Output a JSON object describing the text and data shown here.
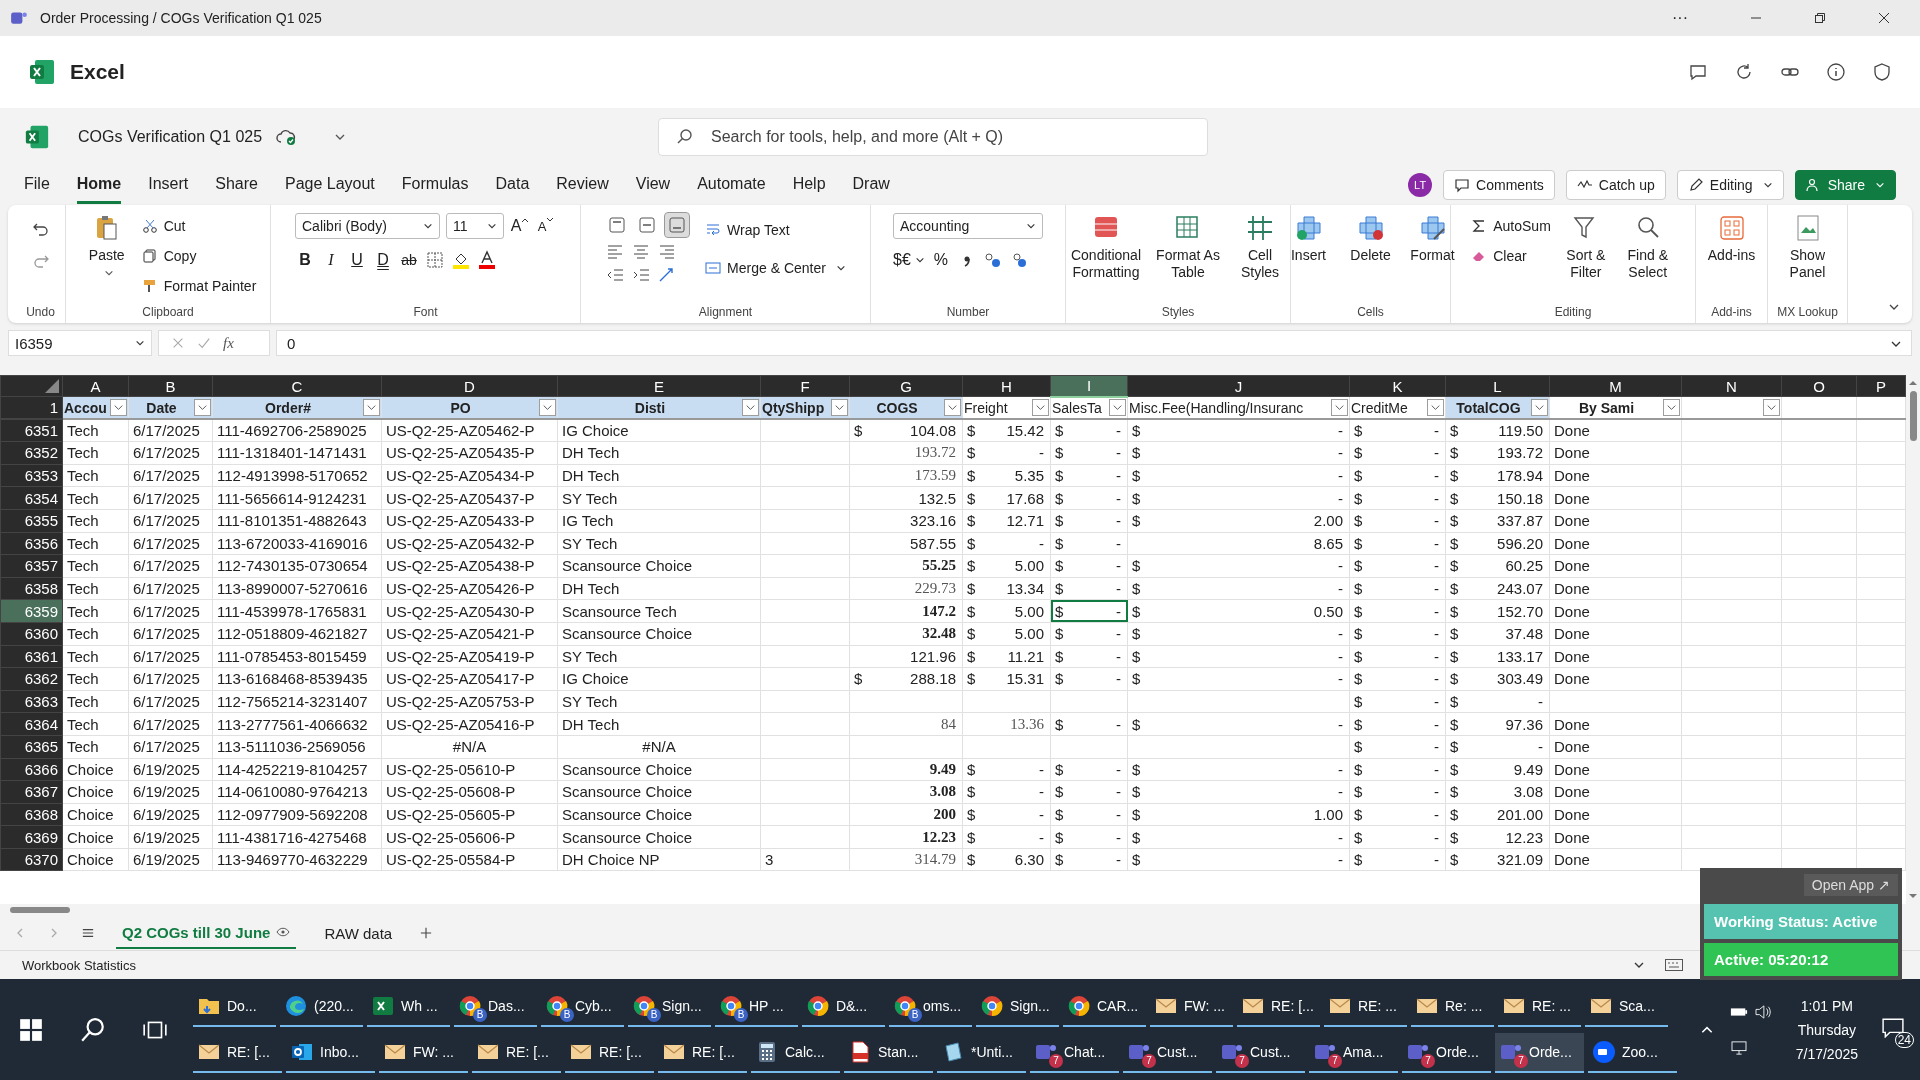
{
  "window": {
    "title": "Order Processing / COGs Verification Q1 025",
    "more": "···"
  },
  "app": {
    "name": "Excel"
  },
  "document": {
    "name": "COGs Verification Q1 025"
  },
  "search": {
    "placeholder": "Search for tools, help, and more (Alt + Q)"
  },
  "menu_tabs": [
    {
      "label": "File",
      "selected": false
    },
    {
      "label": "Home",
      "selected": true
    },
    {
      "label": "Insert",
      "selected": false
    },
    {
      "label": "Share",
      "selected": false
    },
    {
      "label": "Page Layout",
      "selected": false
    },
    {
      "label": "Formulas",
      "selected": false
    },
    {
      "label": "Data",
      "selected": false
    },
    {
      "label": "Review",
      "selected": false
    },
    {
      "label": "View",
      "selected": false
    },
    {
      "label": "Automate",
      "selected": false
    },
    {
      "label": "Help",
      "selected": false
    },
    {
      "label": "Draw",
      "selected": false
    }
  ],
  "header_actions": {
    "avatar": "LT",
    "comments": "Comments",
    "catch_up": "Catch up",
    "editing": "Editing",
    "share": "Share"
  },
  "ribbon": {
    "undo": {
      "label": "Undo"
    },
    "clipboard": {
      "label": "Clipboard",
      "paste": "Paste",
      "cut": "Cut",
      "copy": "Copy",
      "format_painter": "Format Painter"
    },
    "font": {
      "label": "Font",
      "family": "Calibri (Body)",
      "size": "11",
      "grow": "A",
      "shrink": "A",
      "bold": "B",
      "italic": "I",
      "underline": "U",
      "double_underline": "D",
      "strike": "ab"
    },
    "alignment": {
      "label": "Alignment",
      "wrap_text": "Wrap Text",
      "merge": "Merge & Center",
      "valign": [
        {
          "selected": false
        },
        {
          "selected": false
        },
        {
          "selected": true
        }
      ]
    },
    "number": {
      "label": "Number",
      "format": "Accounting",
      "currency": "$€",
      "percent": "%"
    },
    "styles": {
      "label": "Styles",
      "conditional": "Conditional Formatting",
      "format_table": "Format As Table",
      "cell_styles": "Cell Styles"
    },
    "cells": {
      "label": "Cells",
      "insert": "Insert",
      "delete": "Delete",
      "format": "Format"
    },
    "editing": {
      "label": "Editing",
      "autosum": "AutoSum",
      "clear": "Clear",
      "sort": "Sort & Filter",
      "find": "Find & Select"
    },
    "addins": {
      "label": "Add-ins",
      "button": "Add-ins"
    },
    "mx": {
      "label": "MX Lookup",
      "button": "Show Panel"
    }
  },
  "formula_bar": {
    "name_box": "I6359",
    "fx": "fx",
    "value": "0"
  },
  "columns": [
    {
      "letter": "A",
      "selected": false
    },
    {
      "letter": "B",
      "selected": false
    },
    {
      "letter": "C",
      "selected": false
    },
    {
      "letter": "D",
      "selected": false
    },
    {
      "letter": "E",
      "selected": false
    },
    {
      "letter": "F",
      "selected": false
    },
    {
      "letter": "G",
      "selected": false
    },
    {
      "letter": "H",
      "selected": false
    },
    {
      "letter": "I",
      "selected": true
    },
    {
      "letter": "J",
      "selected": false
    },
    {
      "letter": "K",
      "selected": false
    },
    {
      "letter": "L",
      "selected": false
    },
    {
      "letter": "M",
      "selected": false
    },
    {
      "letter": "N",
      "selected": false
    },
    {
      "letter": "O",
      "selected": false
    },
    {
      "letter": "P",
      "selected": false
    }
  ],
  "header_row": {
    "n": "1",
    "cells": [
      {
        "label": "Accou",
        "bold": true,
        "highlight": true
      },
      {
        "label": "Date",
        "bold": true,
        "highlight": true
      },
      {
        "label": "Order#",
        "bold": true,
        "highlight": true
      },
      {
        "label": "PO",
        "bold": true,
        "highlight": true
      },
      {
        "label": "Disti",
        "bold": true,
        "highlight": true
      },
      {
        "label": "QtyShipp",
        "bold": true,
        "highlight": true
      },
      {
        "label": "COGS",
        "bold": true,
        "highlight": true
      },
      {
        "label": "Freight",
        "bold": false,
        "highlight": false
      },
      {
        "label": "SalesTa",
        "bold": false,
        "highlight": false
      },
      {
        "label": "Misc.Fee(Handling/Insuranc",
        "bold": false,
        "highlight": false
      },
      {
        "label": "CreditMe",
        "bold": false,
        "highlight": false
      },
      {
        "label": "TotalCOG",
        "bold": true,
        "highlight": true
      },
      {
        "label": "By Sami",
        "bold": true,
        "highlight": false
      },
      {
        "highlight": false
      }
    ]
  },
  "rows": [
    {
      "n": "6351",
      "selected": false,
      "kind": "ok",
      "account": "Tech",
      "date": "6/17/2025",
      "order": "111-4692706-2589025",
      "po": "US-Q2-25-AZ05462-P",
      "disti": "IG Choice",
      "cogs": {
        "sym": "$",
        "v": "104.08"
      },
      "freight": {
        "sym": "$",
        "v": "15.42"
      },
      "sales_tax": {
        "sym": "$",
        "v": "-"
      },
      "misc_fee": {
        "sym": "$",
        "v": "-"
      },
      "credit_memo": {
        "sym": "$",
        "v": "-"
      },
      "total_cogs": {
        "sym": "$",
        "v": "119.50"
      },
      "by_sami": "Done"
    },
    {
      "n": "6352",
      "selected": false,
      "kind": "ok",
      "account": "Tech",
      "date": "6/17/2025",
      "order": "111-1318401-1471431",
      "po": "US-Q2-25-AZ05435-P",
      "disti": "DH Tech",
      "cogs": {
        "v": "193.72",
        "kind": "serif"
      },
      "freight": {
        "sym": "$",
        "v": "-"
      },
      "sales_tax": {
        "sym": "$",
        "v": "-"
      },
      "misc_fee": {
        "sym": "$",
        "v": "-"
      },
      "credit_memo": {
        "sym": "$",
        "v": "-"
      },
      "total_cogs": {
        "sym": "$",
        "v": "193.72"
      },
      "by_sami": "Done"
    },
    {
      "n": "6353",
      "selected": false,
      "kind": "ok",
      "account": "Tech",
      "date": "6/17/2025",
      "order": "112-4913998-5170652",
      "po": "US-Q2-25-AZ05434-P",
      "disti": "DH Tech",
      "cogs": {
        "v": "173.59",
        "kind": "serif"
      },
      "freight": {
        "sym": "$",
        "v": "5.35"
      },
      "sales_tax": {
        "sym": "$",
        "v": "-"
      },
      "misc_fee": {
        "sym": "$",
        "v": "-"
      },
      "credit_memo": {
        "sym": "$",
        "v": "-"
      },
      "total_cogs": {
        "sym": "$",
        "v": "178.94"
      },
      "by_sami": "Done"
    },
    {
      "n": "6354",
      "selected": false,
      "kind": "ok",
      "account": "Tech",
      "date": "6/17/2025",
      "order": "111-5656614-9124231",
      "po": "US-Q2-25-AZ05437-P",
      "disti": "SY Tech",
      "cogs": {
        "v": "132.5"
      },
      "freight": {
        "sym": "$",
        "v": "17.68"
      },
      "sales_tax": {
        "sym": "$",
        "v": "-"
      },
      "misc_fee": {
        "sym": "$",
        "v": "-"
      },
      "credit_memo": {
        "sym": "$",
        "v": "-"
      },
      "total_cogs": {
        "sym": "$",
        "v": "150.18"
      },
      "by_sami": "Done"
    },
    {
      "n": "6355",
      "selected": false,
      "kind": "ok",
      "account": "Tech",
      "date": "6/17/2025",
      "order": "111-8101351-4882643",
      "po": "US-Q2-25-AZ05433-P",
      "disti": "IG Tech",
      "cogs": {
        "v": "323.16"
      },
      "freight": {
        "sym": "$",
        "v": "12.71"
      },
      "sales_tax": {
        "sym": "$",
        "v": "-"
      },
      "misc_fee": {
        "sym": "$",
        "v": "2.00"
      },
      "credit_memo": {
        "sym": "$",
        "v": "-"
      },
      "total_cogs": {
        "sym": "$",
        "v": "337.87"
      },
      "by_sami": "Done"
    },
    {
      "n": "6356",
      "selected": false,
      "kind": "ok",
      "account": "Tech",
      "date": "6/17/2025",
      "order": "113-6720033-4169016",
      "po": "US-Q2-25-AZ05432-P",
      "disti": "SY Tech",
      "cogs": {
        "v": "587.55"
      },
      "freight": {
        "sym": "$",
        "v": "-"
      },
      "sales_tax": {
        "sym": "$",
        "v": "-"
      },
      "misc_fee": {
        "v": "8.65"
      },
      "credit_memo": {
        "sym": "$",
        "v": "-"
      },
      "total_cogs": {
        "sym": "$",
        "v": "596.20"
      },
      "by_sami": "Done"
    },
    {
      "n": "6357",
      "selected": false,
      "kind": "ok",
      "account": "Tech",
      "date": "6/17/2025",
      "order": "112-7430135-0730654",
      "po": "US-Q2-25-AZ05438-P",
      "disti": "Scansource Choice",
      "cogs": {
        "v": "55.25",
        "kind": "bold"
      },
      "freight": {
        "sym": "$",
        "v": "5.00"
      },
      "sales_tax": {
        "sym": "$",
        "v": "-"
      },
      "misc_fee": {
        "sym": "$",
        "v": "-"
      },
      "credit_memo": {
        "sym": "$",
        "v": "-"
      },
      "total_cogs": {
        "sym": "$",
        "v": "60.25"
      },
      "by_sami": "Done"
    },
    {
      "n": "6358",
      "selected": false,
      "kind": "ok",
      "account": "Tech",
      "date": "6/17/2025",
      "order": "113-8990007-5270616",
      "po": "US-Q2-25-AZ05426-P",
      "disti": "DH Tech",
      "cogs": {
        "v": "229.73",
        "kind": "serif"
      },
      "freight": {
        "sym": "$",
        "v": "13.34"
      },
      "sales_tax": {
        "sym": "$",
        "v": "-"
      },
      "misc_fee": {
        "sym": "$",
        "v": "-"
      },
      "credit_memo": {
        "sym": "$",
        "v": "-"
      },
      "total_cogs": {
        "sym": "$",
        "v": "243.07"
      },
      "by_sami": "Done"
    },
    {
      "n": "6359",
      "selected": true,
      "kind": "ok",
      "account": "Tech",
      "date": "6/17/2025",
      "order": "111-4539978-1765831",
      "po": "US-Q2-25-AZ05430-P",
      "disti": "Scansource Tech",
      "cogs": {
        "v": "147.2",
        "kind": "bold"
      },
      "freight": {
        "sym": "$",
        "v": "5.00"
      },
      "sales_tax": {
        "sym": "$",
        "v": "-"
      },
      "misc_fee": {
        "sym": "$",
        "v": "0.50"
      },
      "credit_memo": {
        "sym": "$",
        "v": "-"
      },
      "total_cogs": {
        "sym": "$",
        "v": "152.70"
      },
      "by_sami": "Done"
    },
    {
      "n": "6360",
      "selected": false,
      "kind": "ok",
      "account": "Tech",
      "date": "6/17/2025",
      "order": "112-0518809-4621827",
      "po": "US-Q2-25-AZ05421-P",
      "disti": "Scansource Choice",
      "cogs": {
        "v": "32.48",
        "kind": "bold"
      },
      "freight": {
        "sym": "$",
        "v": "5.00"
      },
      "sales_tax": {
        "sym": "$",
        "v": "-"
      },
      "misc_fee": {
        "sym": "$",
        "v": "-"
      },
      "credit_memo": {
        "sym": "$",
        "v": "-"
      },
      "total_cogs": {
        "sym": "$",
        "v": "37.48"
      },
      "by_sami": "Done"
    },
    {
      "n": "6361",
      "selected": false,
      "kind": "ok",
      "account": "Tech",
      "date": "6/17/2025",
      "order": "111-0785453-8015459",
      "po": "US-Q2-25-AZ05419-P",
      "disti": "SY Tech",
      "cogs": {
        "v": "121.96"
      },
      "freight": {
        "sym": "$",
        "v": "11.21"
      },
      "sales_tax": {
        "sym": "$",
        "v": "-"
      },
      "misc_fee": {
        "sym": "$",
        "v": "-"
      },
      "credit_memo": {
        "sym": "$",
        "v": "-"
      },
      "total_cogs": {
        "sym": "$",
        "v": "133.17"
      },
      "by_sami": "Done"
    },
    {
      "n": "6362",
      "selected": false,
      "kind": "ok",
      "account": "Tech",
      "date": "6/17/2025",
      "order": "113-6168468-8539435",
      "po": "US-Q2-25-AZ05417-P",
      "disti": "IG Choice",
      "cogs": {
        "sym": "$",
        "v": "288.18"
      },
      "freight": {
        "sym": "$",
        "v": "15.31"
      },
      "sales_tax": {
        "sym": "$",
        "v": "-"
      },
      "misc_fee": {
        "sym": "$",
        "v": "-"
      },
      "credit_memo": {
        "sym": "$",
        "v": "-"
      },
      "total_cogs": {
        "sym": "$",
        "v": "303.49"
      },
      "by_sami": "Done"
    },
    {
      "n": "6363",
      "selected": false,
      "kind": "ok",
      "account": "Tech",
      "date": "6/17/2025",
      "order": "112-7565214-3231407",
      "po": "US-Q2-25-AZ05753-P",
      "disti": "SY Tech",
      "credit_memo": {
        "sym": "$",
        "v": "-"
      },
      "total_cogs": {
        "sym": "$",
        "v": "-"
      }
    },
    {
      "n": "6364",
      "selected": false,
      "kind": "ok",
      "account": "Tech",
      "date": "6/17/2025",
      "order": "113-2777561-4066632",
      "po": "US-Q2-25-AZ05416-P",
      "disti": "DH Tech",
      "cogs": {
        "v": "84",
        "kind": "serif"
      },
      "freight": {
        "v": "13.36",
        "kind": "serif"
      },
      "sales_tax": {
        "sym": "$",
        "v": "-"
      },
      "misc_fee": {
        "sym": "$",
        "v": "-"
      },
      "credit_memo": {
        "sym": "$",
        "v": "-"
      },
      "total_cogs": {
        "sym": "$",
        "v": "97.36"
      },
      "by_sami": "Done"
    },
    {
      "n": "6365",
      "selected": false,
      "kind": "error",
      "account": "Tech",
      "date": "6/17/2025",
      "order": "113-5111036-2569056",
      "po": "#N/A",
      "disti": "#N/A",
      "credit_memo": {
        "sym": "$",
        "v": "-"
      },
      "total_cogs": {
        "sym": "$",
        "v": "-"
      },
      "by_sami": "Done"
    },
    {
      "n": "6366",
      "selected": false,
      "kind": "ok",
      "account": "Choice",
      "date": "6/19/2025",
      "order": "114-4252219-8104257",
      "po": "US-Q2-25-05610-P",
      "disti": "Scansource Choice",
      "cogs": {
        "v": "9.49",
        "kind": "bold"
      },
      "freight": {
        "sym": "$",
        "v": "-"
      },
      "sales_tax": {
        "sym": "$",
        "v": "-"
      },
      "misc_fee": {
        "sym": "$",
        "v": "-"
      },
      "credit_memo": {
        "sym": "$",
        "v": "-"
      },
      "total_cogs": {
        "sym": "$",
        "v": "9.49"
      },
      "by_sami": "Done"
    },
    {
      "n": "6367",
      "selected": false,
      "kind": "ok",
      "account": "Choice",
      "date": "6/19/2025",
      "order": "114-0610080-9764213",
      "po": "US-Q2-25-05608-P",
      "disti": "Scansource Choice",
      "cogs": {
        "v": "3.08",
        "kind": "bold"
      },
      "freight": {
        "sym": "$",
        "v": "-"
      },
      "sales_tax": {
        "sym": "$",
        "v": "-"
      },
      "misc_fee": {
        "sym": "$",
        "v": "-"
      },
      "credit_memo": {
        "sym": "$",
        "v": "-"
      },
      "total_cogs": {
        "sym": "$",
        "v": "3.08"
      },
      "by_sami": "Done"
    },
    {
      "n": "6368",
      "selected": false,
      "kind": "ok",
      "account": "Choice",
      "date": "6/19/2025",
      "order": "112-0977909-5692208",
      "po": "US-Q2-25-05605-P",
      "disti": "Scansource Choice",
      "cogs": {
        "v": "200",
        "kind": "bold"
      },
      "freight": {
        "sym": "$",
        "v": "-"
      },
      "sales_tax": {
        "sym": "$",
        "v": "-"
      },
      "misc_fee": {
        "sym": "$",
        "v": "1.00"
      },
      "credit_memo": {
        "sym": "$",
        "v": "-"
      },
      "total_cogs": {
        "sym": "$",
        "v": "201.00"
      },
      "by_sami": "Done"
    },
    {
      "n": "6369",
      "selected": false,
      "kind": "ok",
      "account": "Choice",
      "date": "6/19/2025",
      "order": "111-4381716-4275468",
      "po": "US-Q2-25-05606-P",
      "disti": "Scansource Choice",
      "cogs": {
        "v": "12.23",
        "kind": "bold"
      },
      "freight": {
        "sym": "$",
        "v": "-"
      },
      "sales_tax": {
        "sym": "$",
        "v": "-"
      },
      "misc_fee": {
        "sym": "$",
        "v": "-"
      },
      "credit_memo": {
        "sym": "$",
        "v": "-"
      },
      "total_cogs": {
        "sym": "$",
        "v": "12.23"
      },
      "by_sami": "Done"
    },
    {
      "n": "6370",
      "selected": false,
      "kind": "ok",
      "account": "Choice",
      "date": "6/19/2025",
      "order": "113-9469770-4632229",
      "po": "US-Q2-25-05584-P",
      "disti": "DH Choice NP",
      "qty": "3",
      "cogs": {
        "v": "314.79",
        "kind": "serif"
      },
      "freight": {
        "sym": "$",
        "v": "6.30"
      },
      "sales_tax": {
        "sym": "$",
        "v": "-"
      },
      "misc_fee": {
        "sym": "$",
        "v": "-"
      },
      "credit_memo": {
        "sym": "$",
        "v": "-"
      },
      "total_cogs": {
        "sym": "$",
        "v": "321.09"
      },
      "by_sami": "Done"
    }
  ],
  "sheet_tabs": [
    {
      "label": "Q2 COGs till 30 June",
      "selected": true
    },
    {
      "label": "RAW data",
      "selected": false
    }
  ],
  "status_bar": {
    "left": "Workbook Statistics"
  },
  "widget": {
    "open_app": "Open App ↗",
    "status": "Working Status: Active",
    "timer": "Active: 05:20:12"
  },
  "taskbar": {
    "upper_apps": [
      {
        "kind": "folder",
        "label": "Do...",
        "selected": false
      },
      {
        "kind": "edge",
        "label": "(220...",
        "selected": false
      },
      {
        "kind": "excel",
        "label": "Wh ...",
        "selected": false
      },
      {
        "kind": "chrome",
        "label": "Das...",
        "badge": "B",
        "selected": false
      },
      {
        "kind": "chrome",
        "label": "Cyb...",
        "badge": "B",
        "selected": false
      },
      {
        "kind": "chrome",
        "label": "Sign...",
        "badge": "B",
        "selected": false
      },
      {
        "kind": "chrome",
        "label": "HP ...",
        "badge": "B",
        "selected": false
      },
      {
        "kind": "chrome",
        "label": "D&...",
        "selected": false
      },
      {
        "kind": "chrome",
        "label": "oms...",
        "badge": "B",
        "selected": false
      },
      {
        "kind": "chrome",
        "label": "Sign...",
        "selected": false
      },
      {
        "kind": "chrome",
        "label": "CAR...",
        "selected": false
      },
      {
        "kind": "mail",
        "label": "FW: ...",
        "selected": false
      },
      {
        "kind": "mail",
        "label": "RE: [...",
        "selected": false
      },
      {
        "kind": "mail",
        "label": "RE: ...",
        "selected": false
      },
      {
        "kind": "mail",
        "label": "Re: ...",
        "selected": false
      },
      {
        "kind": "mail",
        "label": "RE: ...",
        "selected": false
      },
      {
        "kind": "mail",
        "label": "Sca...",
        "selected": false
      }
    ],
    "lower_apps": [
      {
        "kind": "mail",
        "label": "RE: [...",
        "selected": false
      },
      {
        "kind": "outlook",
        "label": "Inbo...",
        "selected": false
      },
      {
        "kind": "mail",
        "label": "FW: ...",
        "selected": false
      },
      {
        "kind": "mail",
        "label": "RE: [...",
        "selected": false
      },
      {
        "kind": "mail",
        "label": "RE: [...",
        "selected": false
      },
      {
        "kind": "mail",
        "label": "RE: [...",
        "selected": false
      },
      {
        "kind": "calc",
        "label": "Calc...",
        "selected": false
      },
      {
        "kind": "pdf",
        "label": "Stan...",
        "selected": false
      },
      {
        "kind": "notepad",
        "label": "*Unti...",
        "selected": false
      },
      {
        "kind": "teams",
        "label": "Chat...",
        "badge": "7",
        "selected": false
      },
      {
        "kind": "teams",
        "label": "Cust...",
        "badge": "7",
        "selected": false
      },
      {
        "kind": "teams",
        "label": "Cust...",
        "badge": "7",
        "selected": false
      },
      {
        "kind": "teams",
        "label": "Ama...",
        "badge": "7",
        "selected": false
      },
      {
        "kind": "teams",
        "label": "Orde...",
        "badge": "7",
        "selected": false
      },
      {
        "kind": "teams",
        "label": "Orde...",
        "badge": "7",
        "selected": true
      },
      {
        "kind": "zoom",
        "label": "Zoo...",
        "selected": false
      }
    ],
    "clock": {
      "time": "1:01 PM",
      "day": "Thursday",
      "date": "7/17/2025"
    },
    "notifications": "24"
  }
}
